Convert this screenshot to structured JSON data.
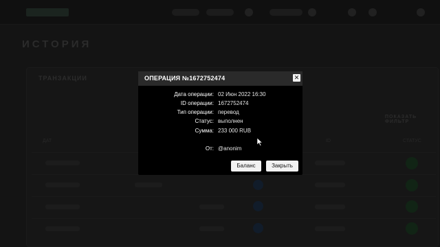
{
  "background": {
    "page_title": "ИСТОРИЯ",
    "tabs": [
      "ТРАНЗАКЦИИ"
    ],
    "table_headers": [
      "ДАТ",
      "ID",
      "СТАТУС"
    ],
    "side_link": "ПОКАЗАТЬ ФИЛЬТР"
  },
  "modal": {
    "title": "ОПЕРАЦИЯ №1672752474",
    "close_glyph": "✕",
    "fields": [
      {
        "label": "Дата операции:",
        "value": "02 Июн 2022 16:30"
      },
      {
        "label": "ID операции:",
        "value": "1672752474"
      },
      {
        "label": "Тип операции:",
        "value": "перевод"
      },
      {
        "label": "Статус:",
        "value": "выполнен"
      },
      {
        "label": "Сумма:",
        "value": "233 000 RUB"
      },
      {
        "label": "От:",
        "value": "@anonim"
      }
    ],
    "buttons": {
      "balance": "Баланс",
      "close": "Закрыть"
    }
  },
  "colors": {
    "overlay": "#000000",
    "modal_bg": "#000000",
    "header_bg": "#2a2a2a",
    "button_bg": "#f2f2f2"
  }
}
